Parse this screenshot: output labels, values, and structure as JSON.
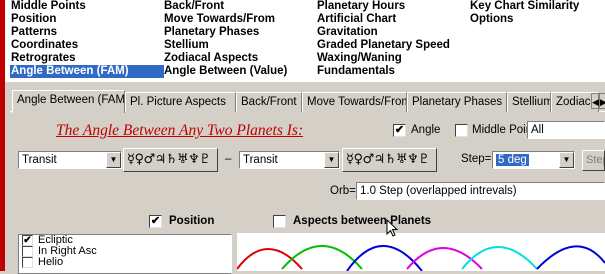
{
  "menu": {
    "col1": [
      "Middle Points",
      "Position",
      "Patterns",
      "Coordinates",
      "Retrogrates",
      "Angle Between (FAM)"
    ],
    "col2": [
      "Back/Front",
      "Move Towards/From",
      "Planetary Phases",
      "Stellium",
      "Zodiacal Aspects",
      "Angle Between (Value)"
    ],
    "col3": [
      "Planetary Hours",
      "Artificial Chart",
      "Gravitation",
      "Graded Planetary Speed",
      "Waxing/Waning",
      "Fundamentals"
    ],
    "col4": [
      "Key Chart Similarity",
      "Options"
    ],
    "selected": "Angle Between (FAM)"
  },
  "tabs": [
    "Angle Between (FAM)",
    "Pl. Picture Aspects",
    "Back/Front",
    "Move Towards/From",
    "Planetary Phases",
    "Stellium",
    "Zodiacal"
  ],
  "active_tab": "Angle Between (FAM)",
  "form": {
    "title": "The Angle Between Any Two Planets Is:",
    "angle_label": "Angle",
    "angle_checked": "✔",
    "middle_points_label": "Middle Points",
    "middle_points_checked": "",
    "range_value": "All",
    "left_type": "Transit",
    "right_type": "Transit",
    "dash": "–",
    "planet_glyphs": "☿♀♂♃♄♅♆♇",
    "step_label": "Step=",
    "step_value": "5 deg",
    "step_button": "Step",
    "orb_label": "Orb=",
    "orb_value": "1.0  Step  (overlapped intrevals)",
    "position_label": "Position",
    "position_checked": "✔",
    "aspects_label": "Aspects between Planets",
    "aspects_checked": ""
  },
  "coords_list": [
    {
      "label": "Ecliptic",
      "checked": "✔"
    },
    {
      "label": "In Right Asc",
      "checked": ""
    },
    {
      "label": "Helio",
      "checked": ""
    }
  ],
  "scroll_arrows": {
    "left": "◀",
    "right": "▶"
  },
  "colors": {
    "title": "#c00000",
    "selection": "#316ac5",
    "wave_red": "#e00000",
    "wave_green": "#00c000",
    "wave_blue": "#0000e0",
    "wave_cyan": "#00e0e0",
    "wave_magenta": "#e000e0"
  }
}
